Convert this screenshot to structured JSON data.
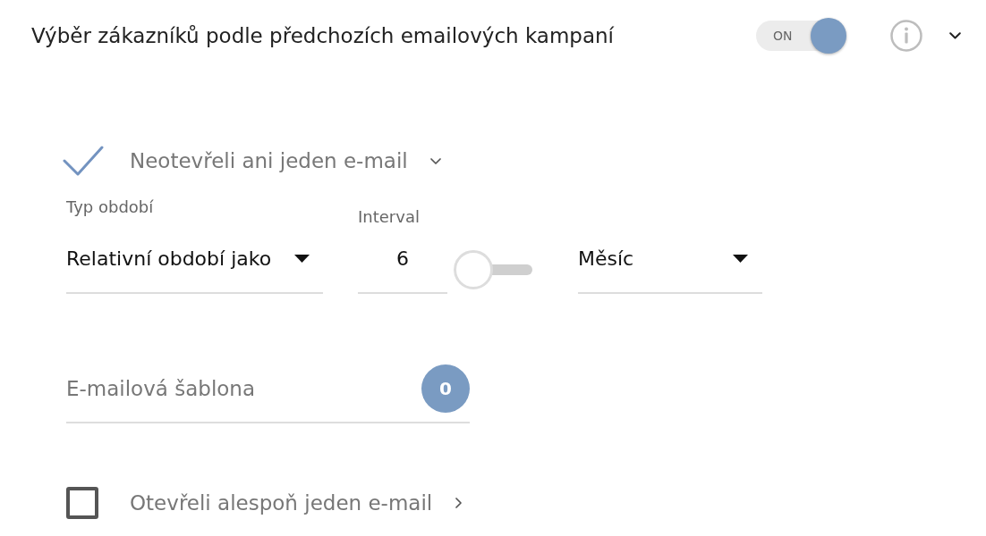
{
  "header": {
    "title": "Výběr zákazníků podle předchozích emailových kampaní",
    "toggle": {
      "label": "ON",
      "on": true
    },
    "expanded": true
  },
  "sections": [
    {
      "label": "Neotevřeli ani jeden e-mail",
      "checked": true,
      "expanded": true,
      "period_type": {
        "label": "Typ období",
        "value": "Relativní období jako"
      },
      "interval": {
        "label": "Interval",
        "value": "6"
      },
      "interval_switch": {
        "on": false
      },
      "unit": {
        "value": "Měsíc"
      },
      "template": {
        "placeholder": "E-mailová šablona",
        "count": "0"
      }
    },
    {
      "label": "Otevřeli alespoň jeden e-mail",
      "checked": false,
      "expanded": false
    }
  ]
}
